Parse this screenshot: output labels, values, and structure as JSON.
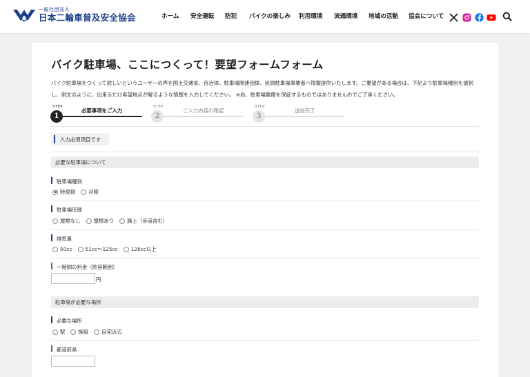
{
  "header": {
    "org_sub": "一般社団法人",
    "org_name": "日本二輪車普及安全協会",
    "nav": [
      "ホーム",
      "安全運転",
      "防犯",
      "バイクの楽しみ",
      "利用環境",
      "流通環境",
      "地域の活動",
      "協会について"
    ],
    "social_icons": [
      "x-icon",
      "instagram-icon",
      "facebook-icon",
      "youtube-icon",
      "search-icon"
    ],
    "colors": {
      "brand": "#1c3f8a",
      "instagram": "#d6249f",
      "facebook": "#1877f2",
      "youtube": "#ff0000"
    }
  },
  "page": {
    "title": "バイク駐車場、ここにつくって！要望フォームフォーム",
    "description": "バイク駐車場をつくって欲しいというユーザーの声を国土交通省、自治体、駐車場関連団体、民間駐車場事業者へ情報提供いたします。ご要望がある場合は、下記より駐車場種別を選択し、例文のように、出来るだけ希望地点が解るような情報を入力してください。 ※尚、駐車場整備を保証するものではありませんのでご了承ください。"
  },
  "steps": [
    {
      "tag": "STEP",
      "number": "1",
      "label": "必要事項をご入力",
      "active": true
    },
    {
      "tag": "STEP",
      "number": "2",
      "label": "ご入力内容の確認",
      "active": false
    },
    {
      "tag": "STEP",
      "number": "3",
      "label": "送信完了",
      "active": false
    }
  ],
  "required_note": "入力必須項目です",
  "sections": {
    "parking": "必要な駐車場について",
    "location": "駐車場が必要な場所"
  },
  "fields": {
    "parking_type": {
      "label": "駐車場種別",
      "options": [
        "時間貸",
        "月極"
      ],
      "selected": "時間貸"
    },
    "parking_form": {
      "label": "駐車場形態",
      "options": [
        "屋根なし",
        "屋根あり",
        "路上（歩道含む）"
      ]
    },
    "displacement": {
      "label": "排気量",
      "options": [
        "50cc",
        "51cc〜125cc",
        "126cc以上"
      ]
    },
    "hourly_fee": {
      "label": "一時間の料金（許容範囲）",
      "value": "",
      "unit": "円"
    },
    "needed_place": {
      "label": "必要な場所",
      "options": [
        "駅",
        "施設",
        "自宅近辺"
      ]
    },
    "prefecture": {
      "label": "都道府県",
      "value": ""
    }
  }
}
